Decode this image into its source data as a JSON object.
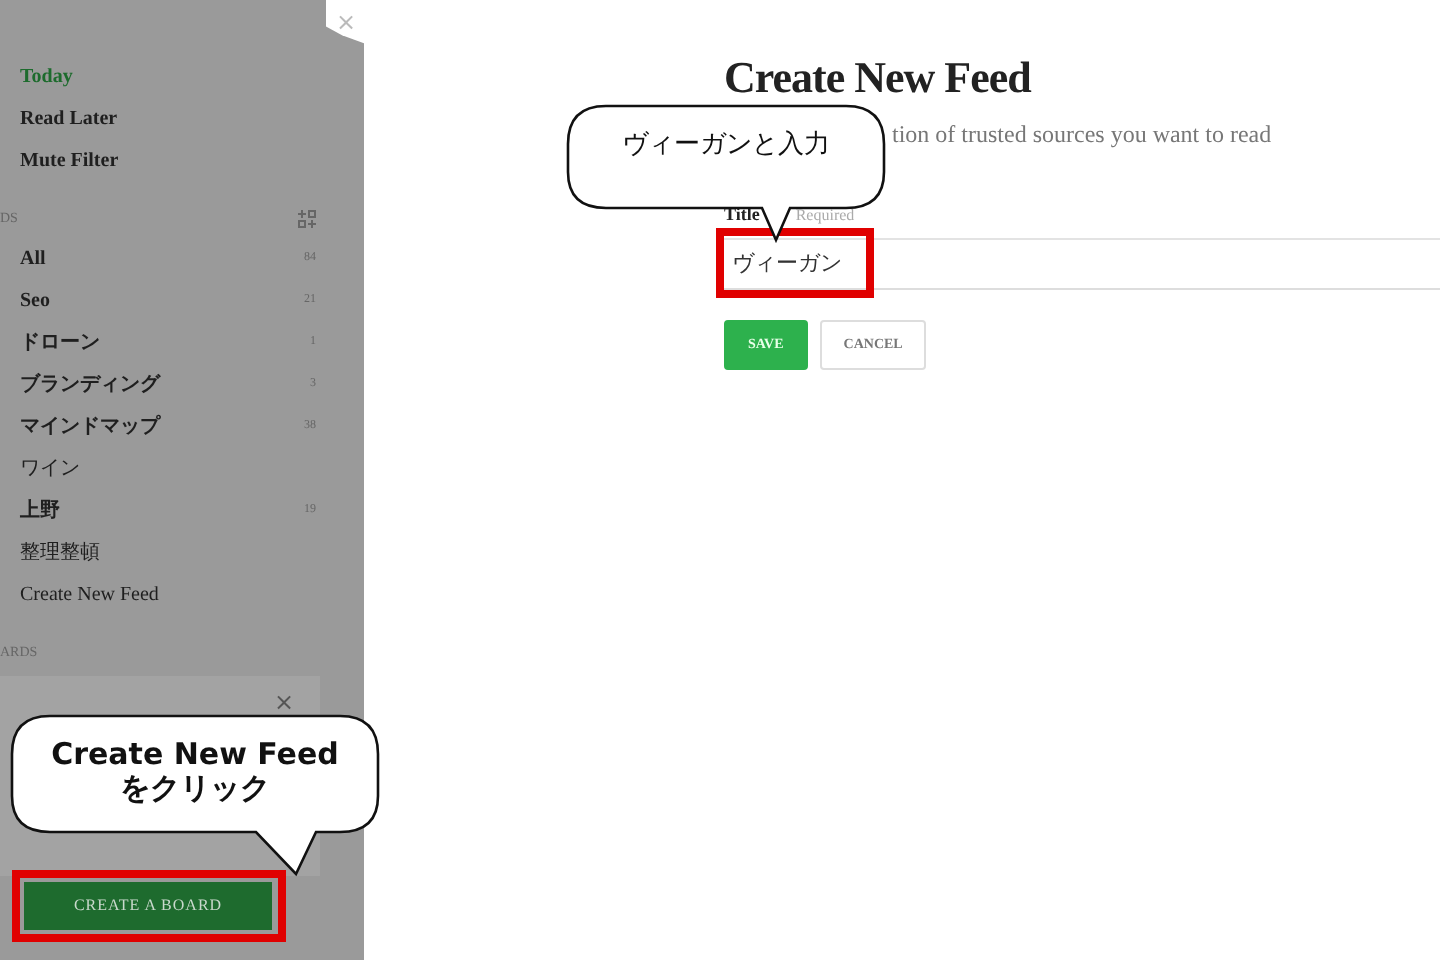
{
  "sidebar": {
    "top_items": [
      {
        "label": "Today",
        "selected": true
      },
      {
        "label": "Read Later",
        "selected": false
      },
      {
        "label": "Mute Filter",
        "selected": false
      }
    ],
    "feeds_header": "DS",
    "feeds": [
      {
        "label": "All",
        "count": "84"
      },
      {
        "label": "Seo",
        "count": "21"
      },
      {
        "label": "ドローン",
        "count": "1"
      },
      {
        "label": "ブランディング",
        "count": "3"
      },
      {
        "label": "マインドマップ",
        "count": "38"
      },
      {
        "label": "ワイン"
      },
      {
        "label": "上野",
        "count": "19"
      },
      {
        "label": "整理整頓"
      },
      {
        "label": "Create New Feed"
      }
    ],
    "boards_header": "ARDS",
    "close_tab": "×",
    "panel_close": "×",
    "create_board_button": "CREATE A BOARD"
  },
  "form": {
    "heading": "Create New Feed",
    "subtitle": "tion of trusted sources you want to read",
    "field_label": "Title",
    "field_hint": "Required",
    "value": "ヴィーガン",
    "buttons": [
      {
        "label": "SAVE",
        "kind": "primary"
      },
      {
        "label": "CANCEL",
        "kind": "secondary"
      }
    ]
  },
  "callouts": [
    {
      "text": "ヴィーガンと入力"
    },
    {
      "text": "Create New Feed\nをクリック"
    }
  ]
}
